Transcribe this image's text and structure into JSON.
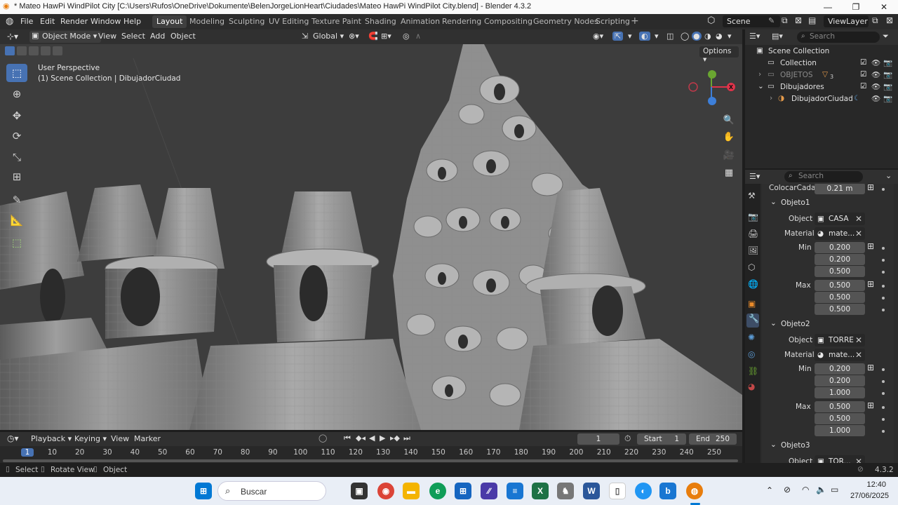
{
  "window": {
    "title": "* Mateo HawPi WindPilot City [C:\\Users\\Rufos\\OneDrive\\Dokumente\\BelenJorgeLionHeart\\Ciudades\\Mateo HawPi WindPilot City.blend] - Blender 4.3.2"
  },
  "menu": [
    "File",
    "Edit",
    "Render",
    "Window",
    "Help"
  ],
  "workspaces": [
    "Layout",
    "Modeling",
    "Sculpting",
    "UV Editing",
    "Texture Paint",
    "Shading",
    "Animation",
    "Rendering",
    "Compositing",
    "Geometry Nodes",
    "Scripting"
  ],
  "active_workspace": "Layout",
  "scene": {
    "scene_name": "Scene",
    "view_layer": "ViewLayer"
  },
  "viewport_header": {
    "mode": "Object Mode",
    "menus": [
      "View",
      "Select",
      "Add",
      "Object"
    ],
    "orientation": "Global",
    "options_label": "Options"
  },
  "viewport": {
    "info_line1": "User Perspective",
    "info_line2": "(1) Scene Collection | DibujadorCiudad",
    "gizmo_axes": {
      "x_color": "#e0334a",
      "y_color": "#6aa631",
      "z_color": "#3d7fd9"
    }
  },
  "outliner": {
    "search_placeholder": "Search",
    "root": "Scene Collection",
    "rows": [
      {
        "label": "Collection"
      },
      {
        "label": "OBJETOS",
        "badge": "3"
      },
      {
        "label": "Dibujadores"
      },
      {
        "label": "DibujadorCiudad"
      }
    ]
  },
  "properties": {
    "search_placeholder": "Search",
    "colocar_label": "ColocarCada",
    "colocar_value": "0.21 m",
    "objects": [
      {
        "section": "Objeto1",
        "object_label": "Object",
        "object": "CASA",
        "material_label": "Material",
        "material": "mate...",
        "min_label": "Min",
        "min": [
          "0.200",
          "0.200",
          "0.500"
        ],
        "max_label": "Max",
        "max": [
          "0.500",
          "0.500",
          "0.500"
        ]
      },
      {
        "section": "Objeto2",
        "object_label": "Object",
        "object": "TORRE",
        "material_label": "Material",
        "material": "mate...",
        "min_label": "Min",
        "min": [
          "0.200",
          "0.200",
          "1.000"
        ],
        "max_label": "Max",
        "max": [
          "0.500",
          "0.500",
          "1.000"
        ]
      },
      {
        "section": "Objeto3",
        "object_label": "Object",
        "object": "TOR..."
      }
    ]
  },
  "timeline": {
    "menus": [
      "Playback",
      "Keying",
      "View",
      "Marker"
    ],
    "current_frame": "1",
    "start_label": "Start",
    "start": "1",
    "end_label": "End",
    "end": "250",
    "ticks": [
      "1",
      "10",
      "20",
      "30",
      "40",
      "50",
      "60",
      "70",
      "80",
      "90",
      "100",
      "110",
      "120",
      "130",
      "140",
      "150",
      "160",
      "170",
      "180",
      "190",
      "200",
      "210",
      "220",
      "230",
      "240",
      "250"
    ]
  },
  "statusbar": {
    "select": "Select",
    "rotate": "Rotate View",
    "object": "Object",
    "version": "4.3.2"
  },
  "taskbar": {
    "search_placeholder": "Buscar",
    "time": "12:40",
    "date": "27/06/2025"
  }
}
